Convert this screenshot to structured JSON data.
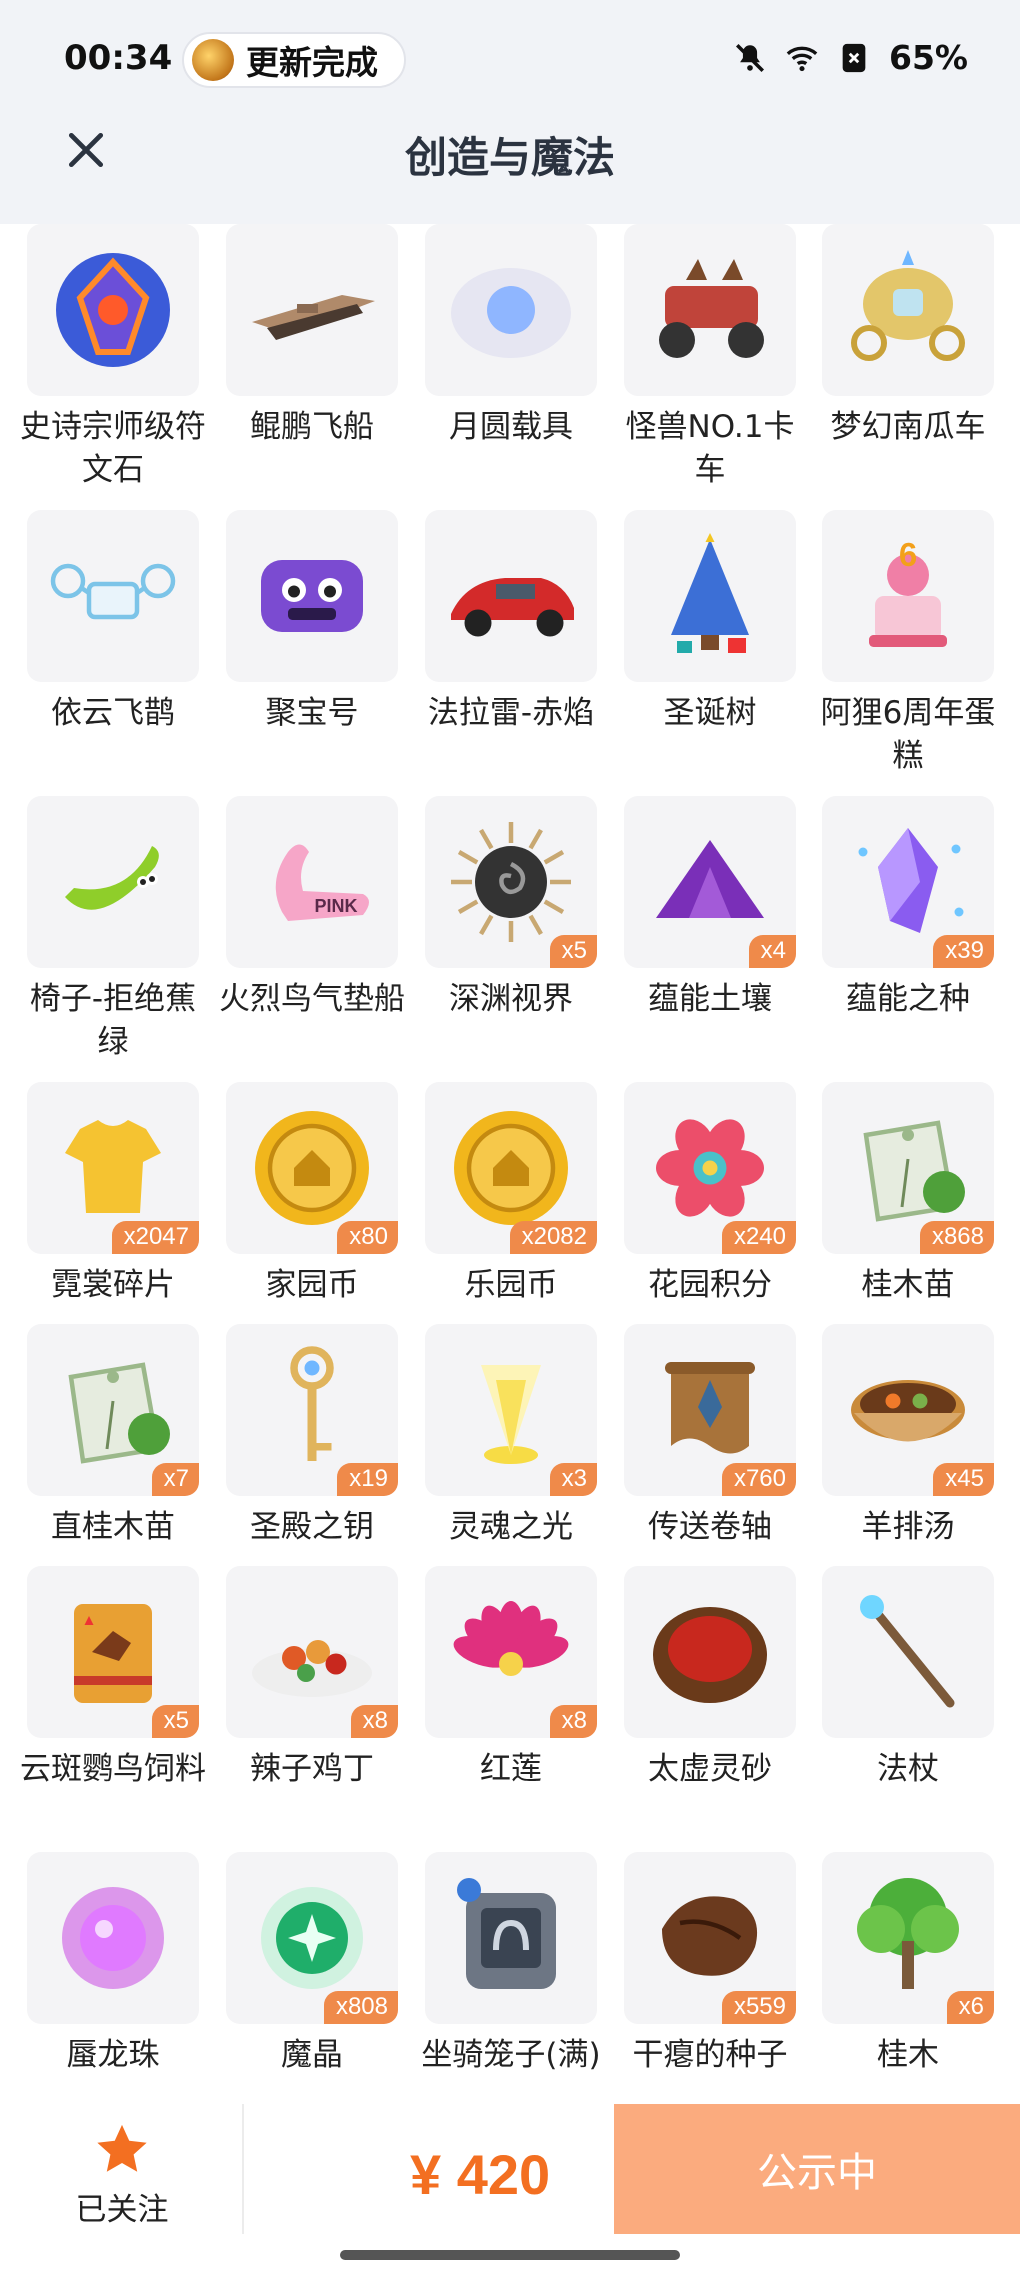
{
  "status_bar": {
    "time": "00:34",
    "update_text": "更新完成",
    "battery": "65%"
  },
  "header": {
    "title": "创造与魔法"
  },
  "items": [
    {
      "name": "史诗宗师级符文石",
      "count": "",
      "icon": "rune-stone-icon",
      "color": "#6b4fd8"
    },
    {
      "name": "鲲鹏飞船",
      "count": "",
      "icon": "airship-icon",
      "color": "#b08a6a"
    },
    {
      "name": "月圆载具",
      "count": "",
      "icon": "moon-vehicle-icon",
      "color": "#8fb6ff"
    },
    {
      "name": "怪兽NO.1卡车",
      "count": "",
      "icon": "monster-truck-icon",
      "color": "#c0443a"
    },
    {
      "name": "梦幻南瓜车",
      "count": "",
      "icon": "pumpkin-carriage-icon",
      "color": "#e3c66a"
    },
    {
      "name": "依云飞鹊",
      "count": "",
      "icon": "drone-icon",
      "color": "#7cc4e8"
    },
    {
      "name": "聚宝号",
      "count": "",
      "icon": "treasure-vehicle-icon",
      "color": "#7b4bd1"
    },
    {
      "name": "法拉雷-赤焰",
      "count": "",
      "icon": "red-car-icon",
      "color": "#d32a2a"
    },
    {
      "name": "圣诞树",
      "count": "",
      "icon": "christmas-tree-icon",
      "color": "#3c6fd6"
    },
    {
      "name": "阿狸6周年蛋糕",
      "count": "",
      "icon": "cake-icon",
      "color": "#f07fa6"
    },
    {
      "name": "椅子-拒绝蕉绿",
      "count": "",
      "icon": "banana-chair-icon",
      "color": "#8fce2a"
    },
    {
      "name": "火烈鸟气垫船",
      "count": "",
      "icon": "flamingo-float-icon",
      "color": "#f6a6c8"
    },
    {
      "name": "深渊视界",
      "count": "x5",
      "icon": "abyss-icon",
      "color": "#333333"
    },
    {
      "name": "蕴能土壤",
      "count": "x4",
      "icon": "soil-icon",
      "color": "#7a2fb8"
    },
    {
      "name": "蕴能之种",
      "count": "x39",
      "icon": "crystal-seed-icon",
      "color": "#8a5cf0"
    },
    {
      "name": "霓裳碎片",
      "count": "x2047",
      "icon": "shirt-fragment-icon",
      "color": "#f5c331"
    },
    {
      "name": "家园币",
      "count": "x80",
      "icon": "home-coin-icon",
      "color": "#f1b61c"
    },
    {
      "name": "乐园币",
      "count": "x2082",
      "icon": "park-coin-icon",
      "color": "#f1b61c"
    },
    {
      "name": "花园积分",
      "count": "x240",
      "icon": "flower-badge-icon",
      "color": "#ec4e6a"
    },
    {
      "name": "桂木苗",
      "count": "x868",
      "icon": "seed-pack-icon",
      "color": "#9bb88a"
    },
    {
      "name": "直桂木苗",
      "count": "x7",
      "icon": "seed-pack-icon",
      "color": "#9bb88a"
    },
    {
      "name": "圣殿之钥",
      "count": "x19",
      "icon": "key-icon",
      "color": "#e0b45c"
    },
    {
      "name": "灵魂之光",
      "count": "x3",
      "icon": "soul-light-icon",
      "color": "#f7dc45"
    },
    {
      "name": "传送卷轴",
      "count": "x760",
      "icon": "scroll-icon",
      "color": "#a8733a"
    },
    {
      "name": "羊排汤",
      "count": "x45",
      "icon": "soup-icon",
      "color": "#c98a3a"
    },
    {
      "name": "云斑鹦鸟饲料",
      "count": "x5",
      "icon": "feed-bag-icon",
      "color": "#e8a033"
    },
    {
      "name": "辣子鸡丁",
      "count": "x8",
      "icon": "spicy-chicken-icon",
      "color": "#e05a26"
    },
    {
      "name": "红莲",
      "count": "x8",
      "icon": "lotus-icon",
      "color": "#e0307e"
    },
    {
      "name": "太虚灵砂",
      "count": "",
      "icon": "red-sand-icon",
      "color": "#c8281e"
    },
    {
      "name": "法杖",
      "count": "",
      "icon": "staff-icon",
      "color": "#7c5a3a"
    },
    {
      "name": "蜃龙珠",
      "count": "",
      "icon": "dragon-pearl-icon",
      "color": "#c43ae0"
    },
    {
      "name": "魔晶",
      "count": "x808",
      "icon": "magic-crystal-icon",
      "color": "#1fae6a"
    },
    {
      "name": "坐骑笼子(满)",
      "count": "",
      "icon": "mount-cage-icon",
      "color": "#6d7684"
    },
    {
      "name": "干瘪的种子",
      "count": "x559",
      "icon": "dried-seed-icon",
      "color": "#6b3a1e"
    },
    {
      "name": "桂木",
      "count": "x6",
      "icon": "tree-icon",
      "color": "#4caf3a"
    }
  ],
  "bottom_bar": {
    "follow_label": "已关注",
    "price": "¥ 420",
    "status_button": "公示中"
  },
  "colors": {
    "accent": "#f36f21",
    "badge": "#ef8a4a",
    "status_button_bg": "#fbab7e"
  }
}
